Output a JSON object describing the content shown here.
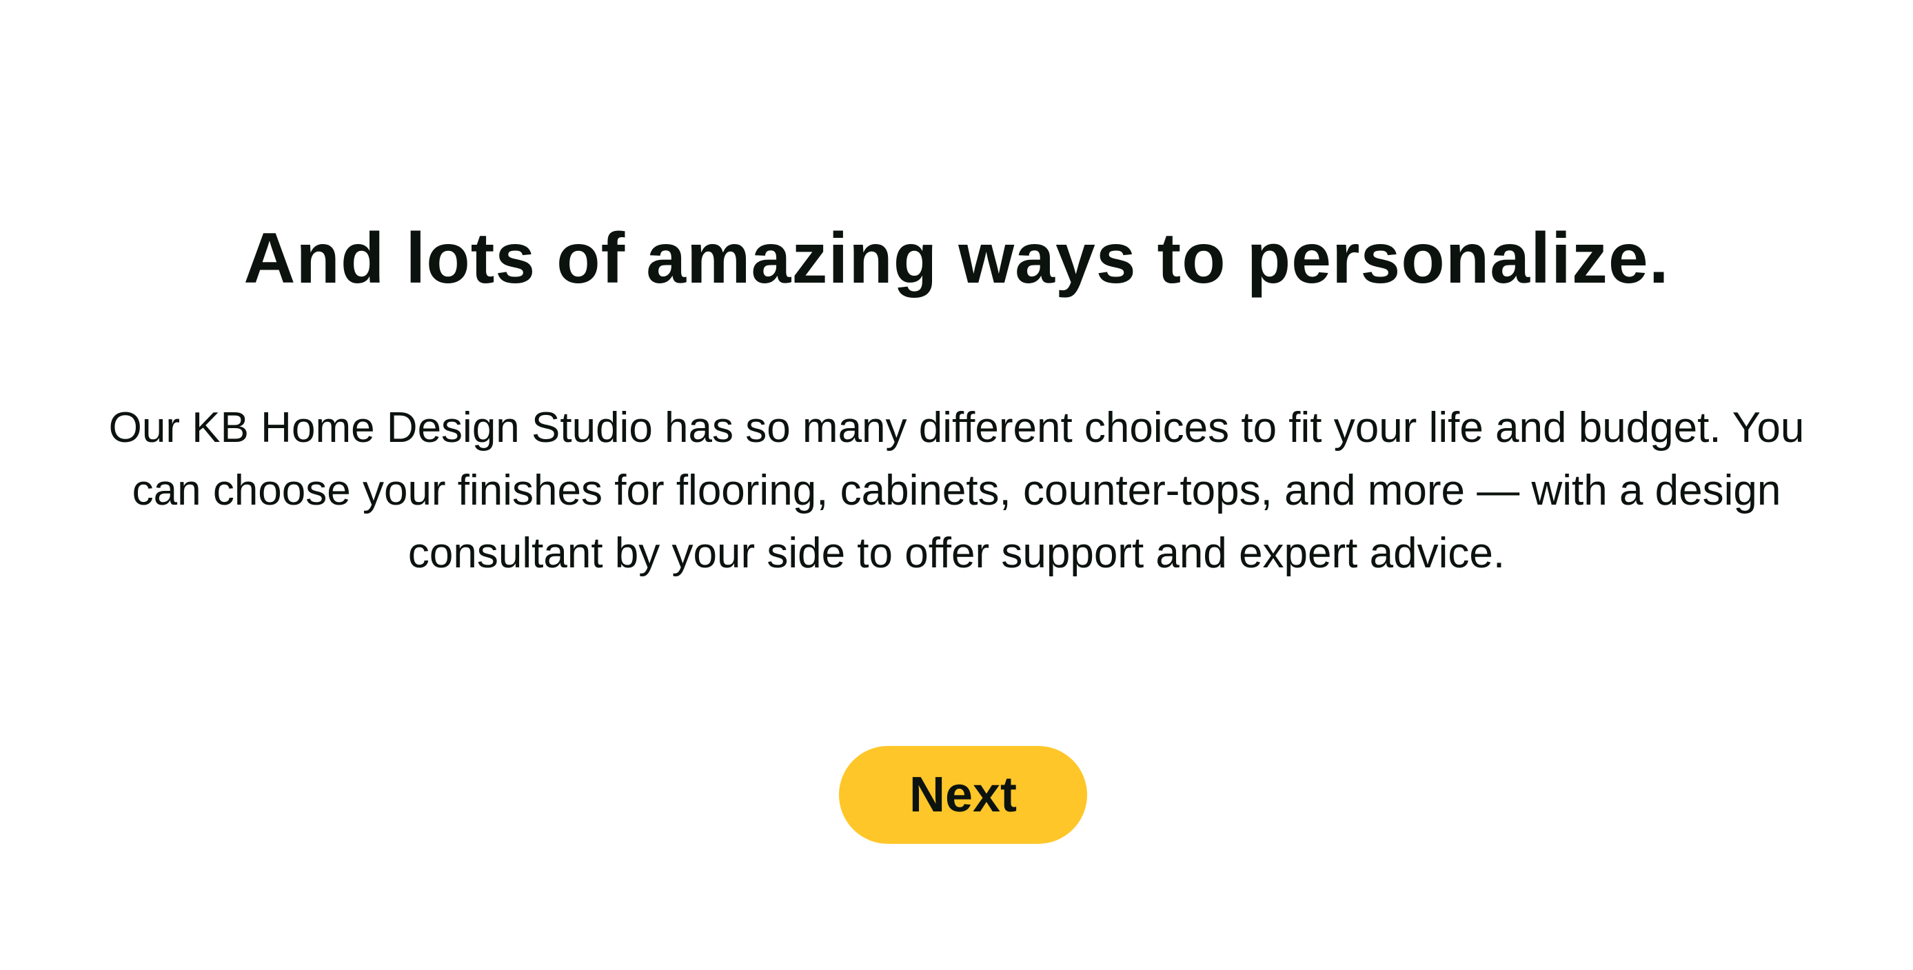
{
  "heading": "And lots of amazing ways to personalize.",
  "description": "Our KB Home Design Studio has so many different choices to fit your life and budget. You can choose your finishes for flooring, cabinets, counter-tops, and more — with a design consultant by your side to offer support and expert advice.",
  "next_button": {
    "label": "Next",
    "color": "#FFC629"
  }
}
